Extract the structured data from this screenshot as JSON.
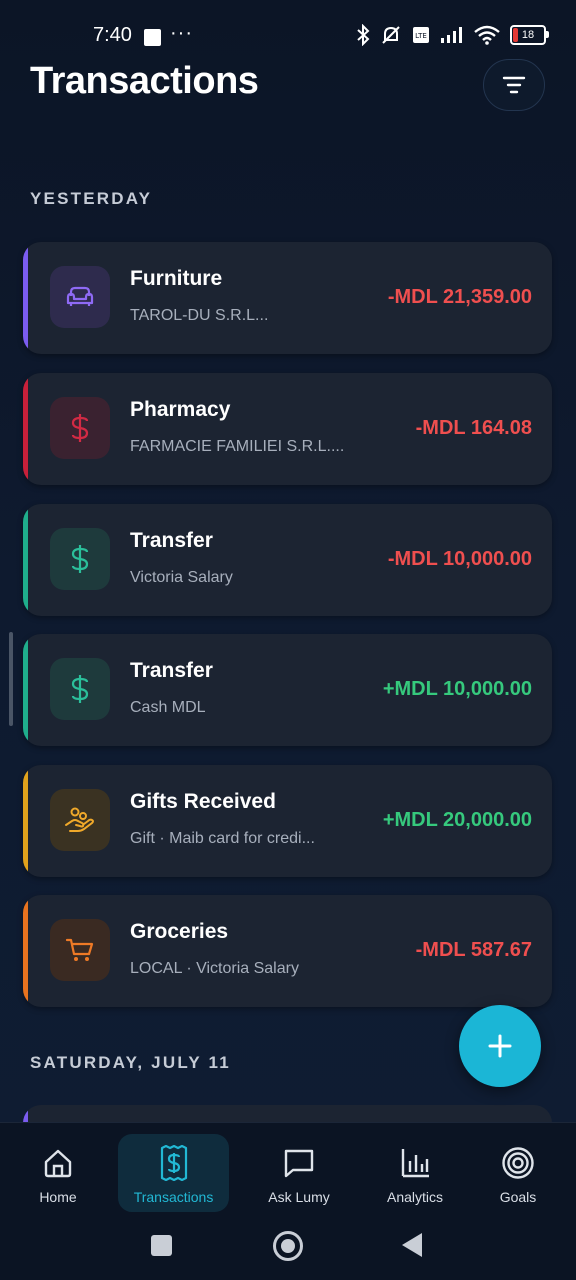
{
  "status_bar": {
    "time": "7:40",
    "dots": "···",
    "battery_level": "18"
  },
  "header": {
    "title": "Transactions"
  },
  "sections": [
    {
      "label": "YESTERDAY"
    },
    {
      "label": "SATURDAY, JULY 11"
    }
  ],
  "transactions": [
    {
      "title": "Furniture",
      "subtitle": "TAROL-DU S.R.L...",
      "amount": "-MDL 21,359.00",
      "type": "negative",
      "accent": "#7b5cf0",
      "icon": "sofa-icon",
      "icon_color": "#8f6af5",
      "icon_bg": "#2e2b4d"
    },
    {
      "title": "Pharmacy",
      "subtitle": "FARMACIE FAMILIEI S.R.L....",
      "amount": "-MDL 164.08",
      "type": "negative",
      "accent": "#c8203a",
      "icon": "dollar-icon",
      "icon_color": "#d22a44",
      "icon_bg": "#3a2230"
    },
    {
      "title": "Transfer",
      "subtitle": "Victoria Salary",
      "amount": "-MDL 10,000.00",
      "type": "negative",
      "accent": "#1fae8c",
      "icon": "dollar-icon",
      "icon_color": "#2bbf9a",
      "icon_bg": "#1e3a3c"
    },
    {
      "title": "Transfer",
      "subtitle": "Cash MDL",
      "amount": "+MDL 10,000.00",
      "type": "positive",
      "accent": "#1fae8c",
      "icon": "dollar-icon",
      "icon_color": "#2bbf9a",
      "icon_bg": "#1e3a3c"
    },
    {
      "title": "Gifts Received",
      "subtitle": "Gift · Maib card for credi...",
      "amount": "+MDL 20,000.00",
      "type": "positive",
      "accent": "#e0a21c",
      "icon": "gift-hand-icon",
      "icon_color": "#f0a92a",
      "icon_bg": "#3a3222"
    },
    {
      "title": "Groceries",
      "subtitle": "LOCAL · Victoria Salary",
      "amount": "-MDL 587.67",
      "type": "negative",
      "accent": "#e8731f",
      "icon": "cart-icon",
      "icon_color": "#ef7a26",
      "icon_bg": "#3a2a22"
    }
  ],
  "bottom_nav": [
    {
      "label": "Home",
      "icon": "home-icon"
    },
    {
      "label": "Transactions",
      "icon": "receipt-icon",
      "active": true
    },
    {
      "label": "Ask Lumy",
      "icon": "chat-icon"
    },
    {
      "label": "Analytics",
      "icon": "bar-chart-icon"
    },
    {
      "label": "Goals",
      "icon": "target-icon"
    }
  ],
  "colors": {
    "negative": "#ef4f4f",
    "positive": "#36c97d",
    "accent": "#1bb6d6"
  }
}
